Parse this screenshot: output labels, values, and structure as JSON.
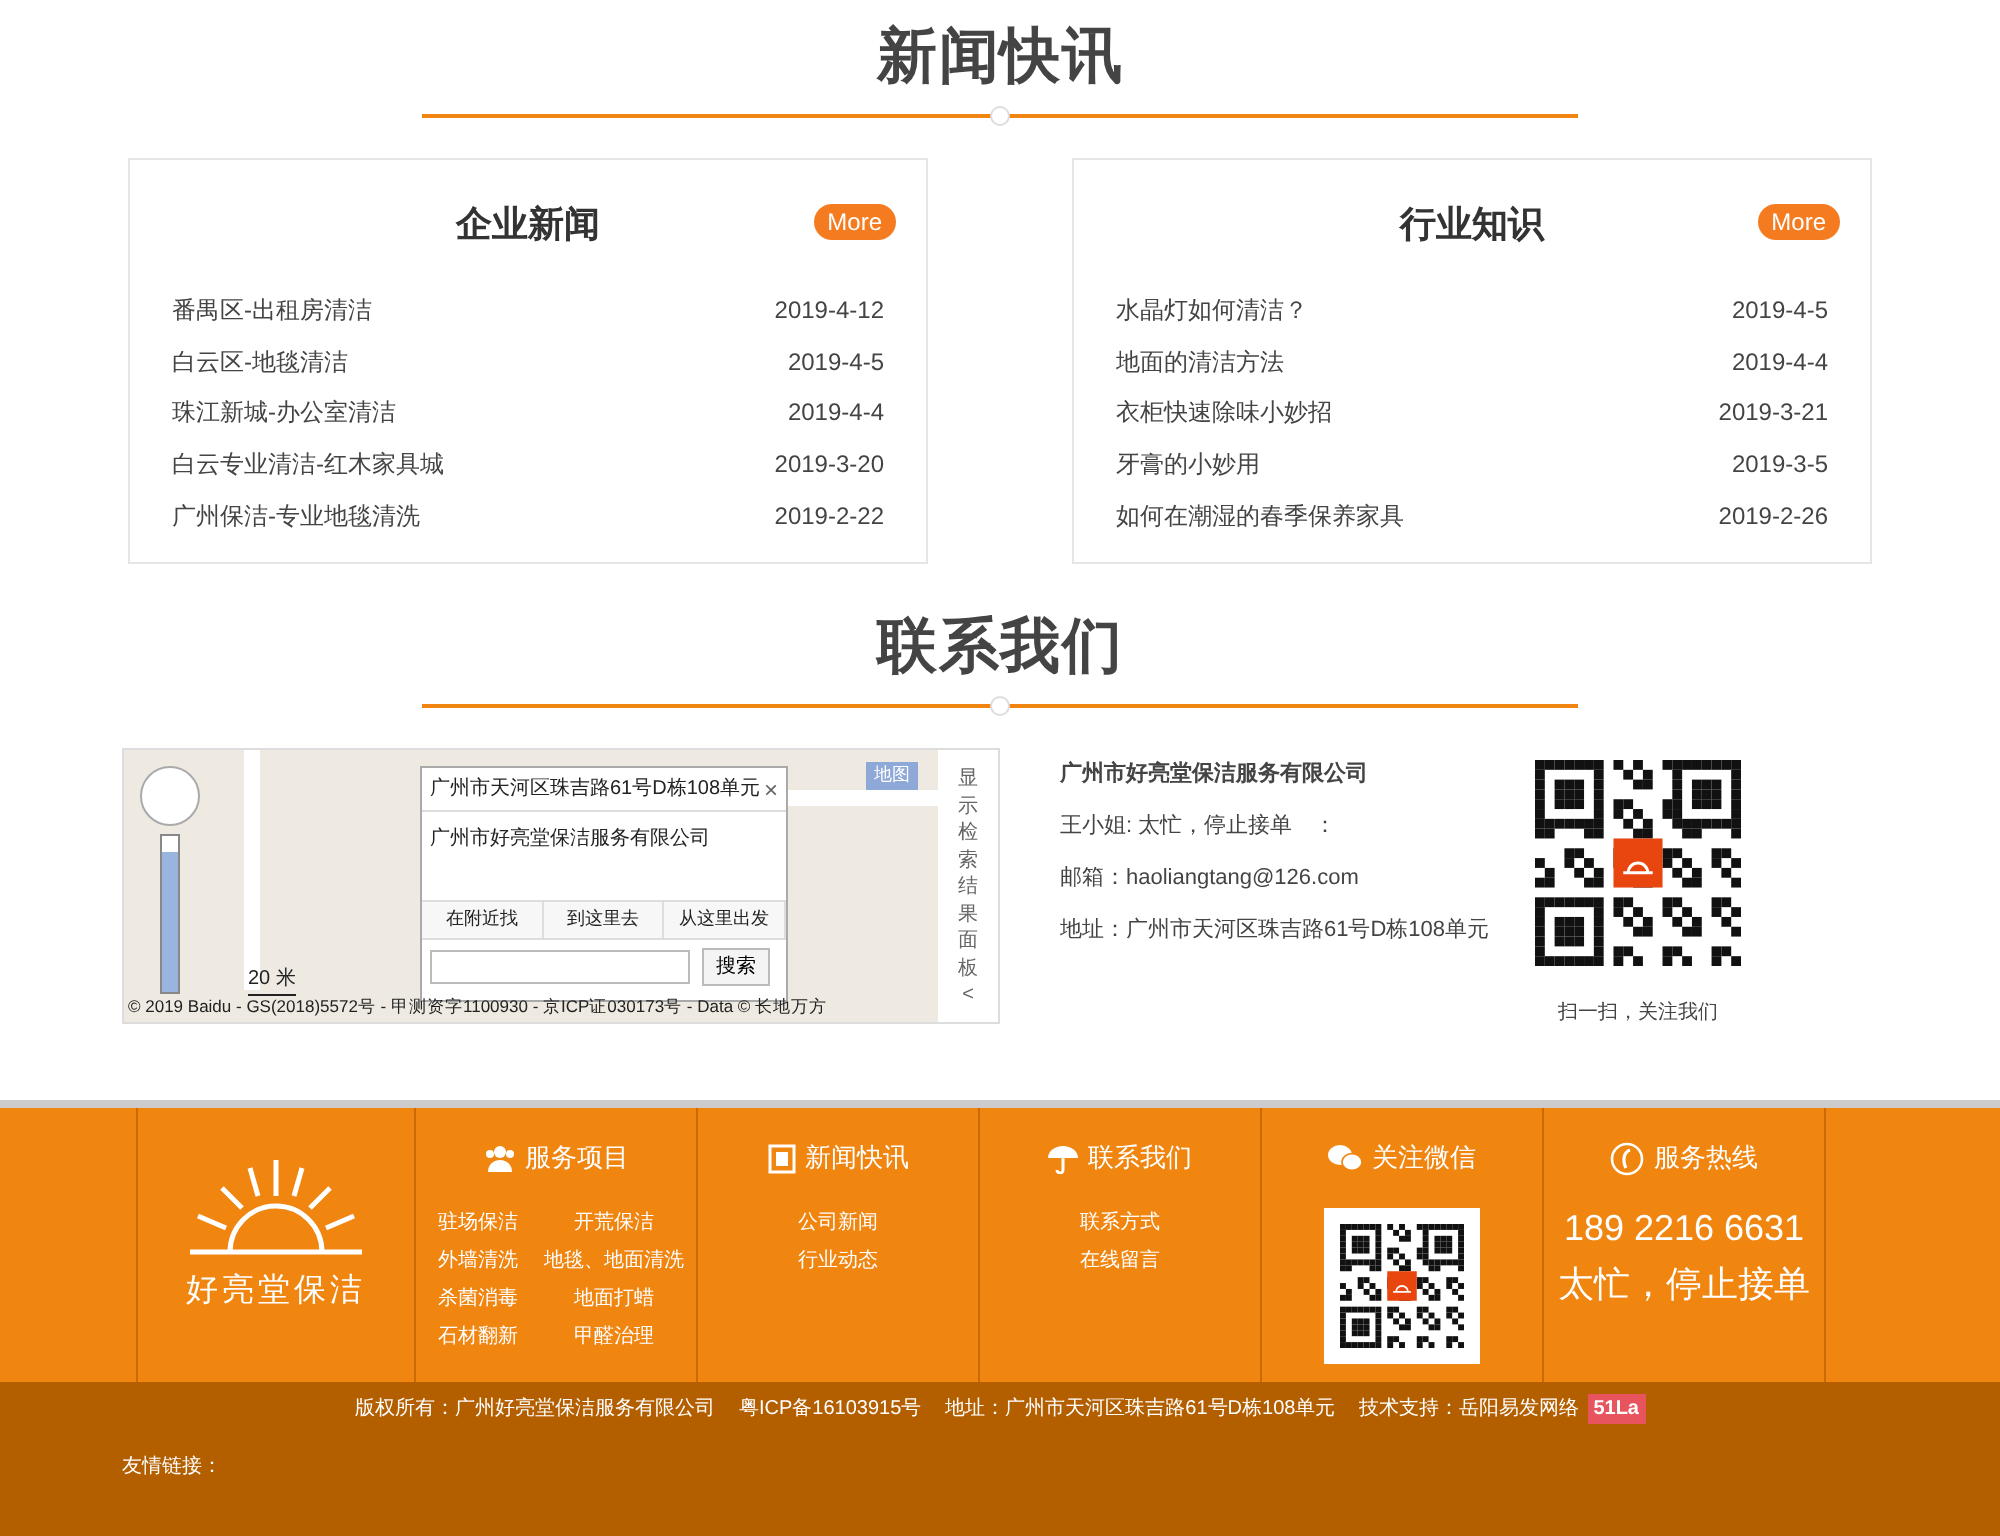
{
  "news_section": {
    "title": "新闻快讯",
    "cards": [
      {
        "title": "企业新闻",
        "more": "More",
        "items": [
          {
            "title": "番禺区-出租房清洁",
            "date": "2019-4-12"
          },
          {
            "title": "白云区-地毯清洁",
            "date": "2019-4-5"
          },
          {
            "title": "珠江新城-办公室清洁",
            "date": "2019-4-4"
          },
          {
            "title": "白云专业清洁-红木家具城",
            "date": "2019-3-20"
          },
          {
            "title": "广州保洁-专业地毯清洗",
            "date": "2019-2-22"
          }
        ]
      },
      {
        "title": "行业知识",
        "more": "More",
        "items": [
          {
            "title": "水晶灯如何清洁？",
            "date": "2019-4-5"
          },
          {
            "title": "地面的清洁方法",
            "date": "2019-4-4"
          },
          {
            "title": "衣柜快速除味小妙招",
            "date": "2019-3-21"
          },
          {
            "title": "牙膏的小妙用",
            "date": "2019-3-5"
          },
          {
            "title": "如何在潮湿的春季保养家具",
            "date": "2019-2-26"
          }
        ]
      }
    ]
  },
  "contact_section": {
    "title": "联系我们",
    "map": {
      "popup_title": "广州市天河区珠吉路61号D栋108单元",
      "close": "×",
      "zoom_slider": {
        "level": 0.9
      },
      "popup_text": "广州市好亮堂保洁服务有限公司",
      "popup_tabs": [
        "在附近找",
        "到这里去",
        "从这里出发"
      ],
      "search_button": "搜索",
      "map_type_button": "地图",
      "scale": "20 米",
      "copyright": "© 2019 Baidu - GS(2018)5572号 - 甲测资字1100930 - 京ICP证030173号 - Data © 长地万方",
      "panel_toggle": "显示检索结果面板<"
    },
    "company": "广州市好亮堂保洁服务有限公司",
    "contact_person": "王小姐: 太忙，停止接单　：",
    "email": "邮箱：haoliangtang@126.com",
    "address": "地址：广州市天河区珠吉路61号D栋108单元",
    "qr_caption": "扫一扫，关注我们"
  },
  "footer": {
    "logo_text": "好亮堂保洁",
    "columns": [
      {
        "kind": "links2",
        "title": "服务项目",
        "links": [
          "驻场保洁",
          "开荒保洁",
          "外墙清洗",
          "地毯、地面清洗",
          "杀菌消毒",
          "地面打蜡",
          "石材翻新",
          "甲醛治理"
        ]
      },
      {
        "kind": "links",
        "title": "新闻快讯",
        "links": [
          "公司新闻",
          "行业动态"
        ]
      },
      {
        "kind": "links",
        "title": "联系我们",
        "links": [
          "联系方式",
          "在线留言"
        ]
      },
      {
        "kind": "qr",
        "title": "关注微信"
      },
      {
        "kind": "hotline",
        "title": "服务热线",
        "phone": "189 2216 6631",
        "note": "太忙，停止接单"
      }
    ],
    "copyright": "版权所有：广州好亮堂保洁服务有限公司",
    "icp": "粤ICP备16103915号",
    "address": "地址：广州市天河区珠吉路61号D栋108单元",
    "support": "技术支持：岳阳易发网络",
    "badge": "51La",
    "friend_links": "友情链接："
  }
}
